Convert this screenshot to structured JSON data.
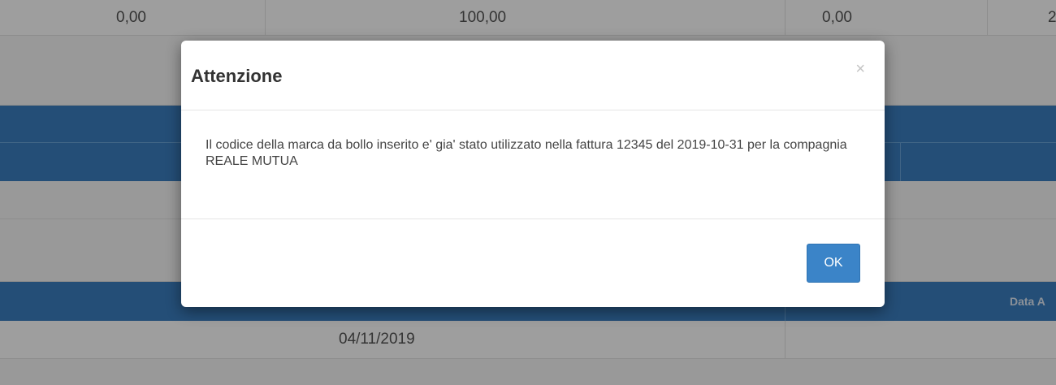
{
  "background": {
    "row1_values": [
      "0,00",
      "100,00",
      "0,00",
      "2"
    ],
    "header_text": "Data A",
    "date_value": "04/11/2019"
  },
  "modal": {
    "title": "Attenzione",
    "close_symbol": "×",
    "message": "Il codice della marca da bollo inserito e' gia' stato utilizzato nella fattura 12345 del 2019-10-31 per la compagnia REALE MUTUA",
    "ok_label": "OK"
  },
  "colors": {
    "header_blue": "#3a7fc1",
    "ok_button": "#3b84c8"
  }
}
